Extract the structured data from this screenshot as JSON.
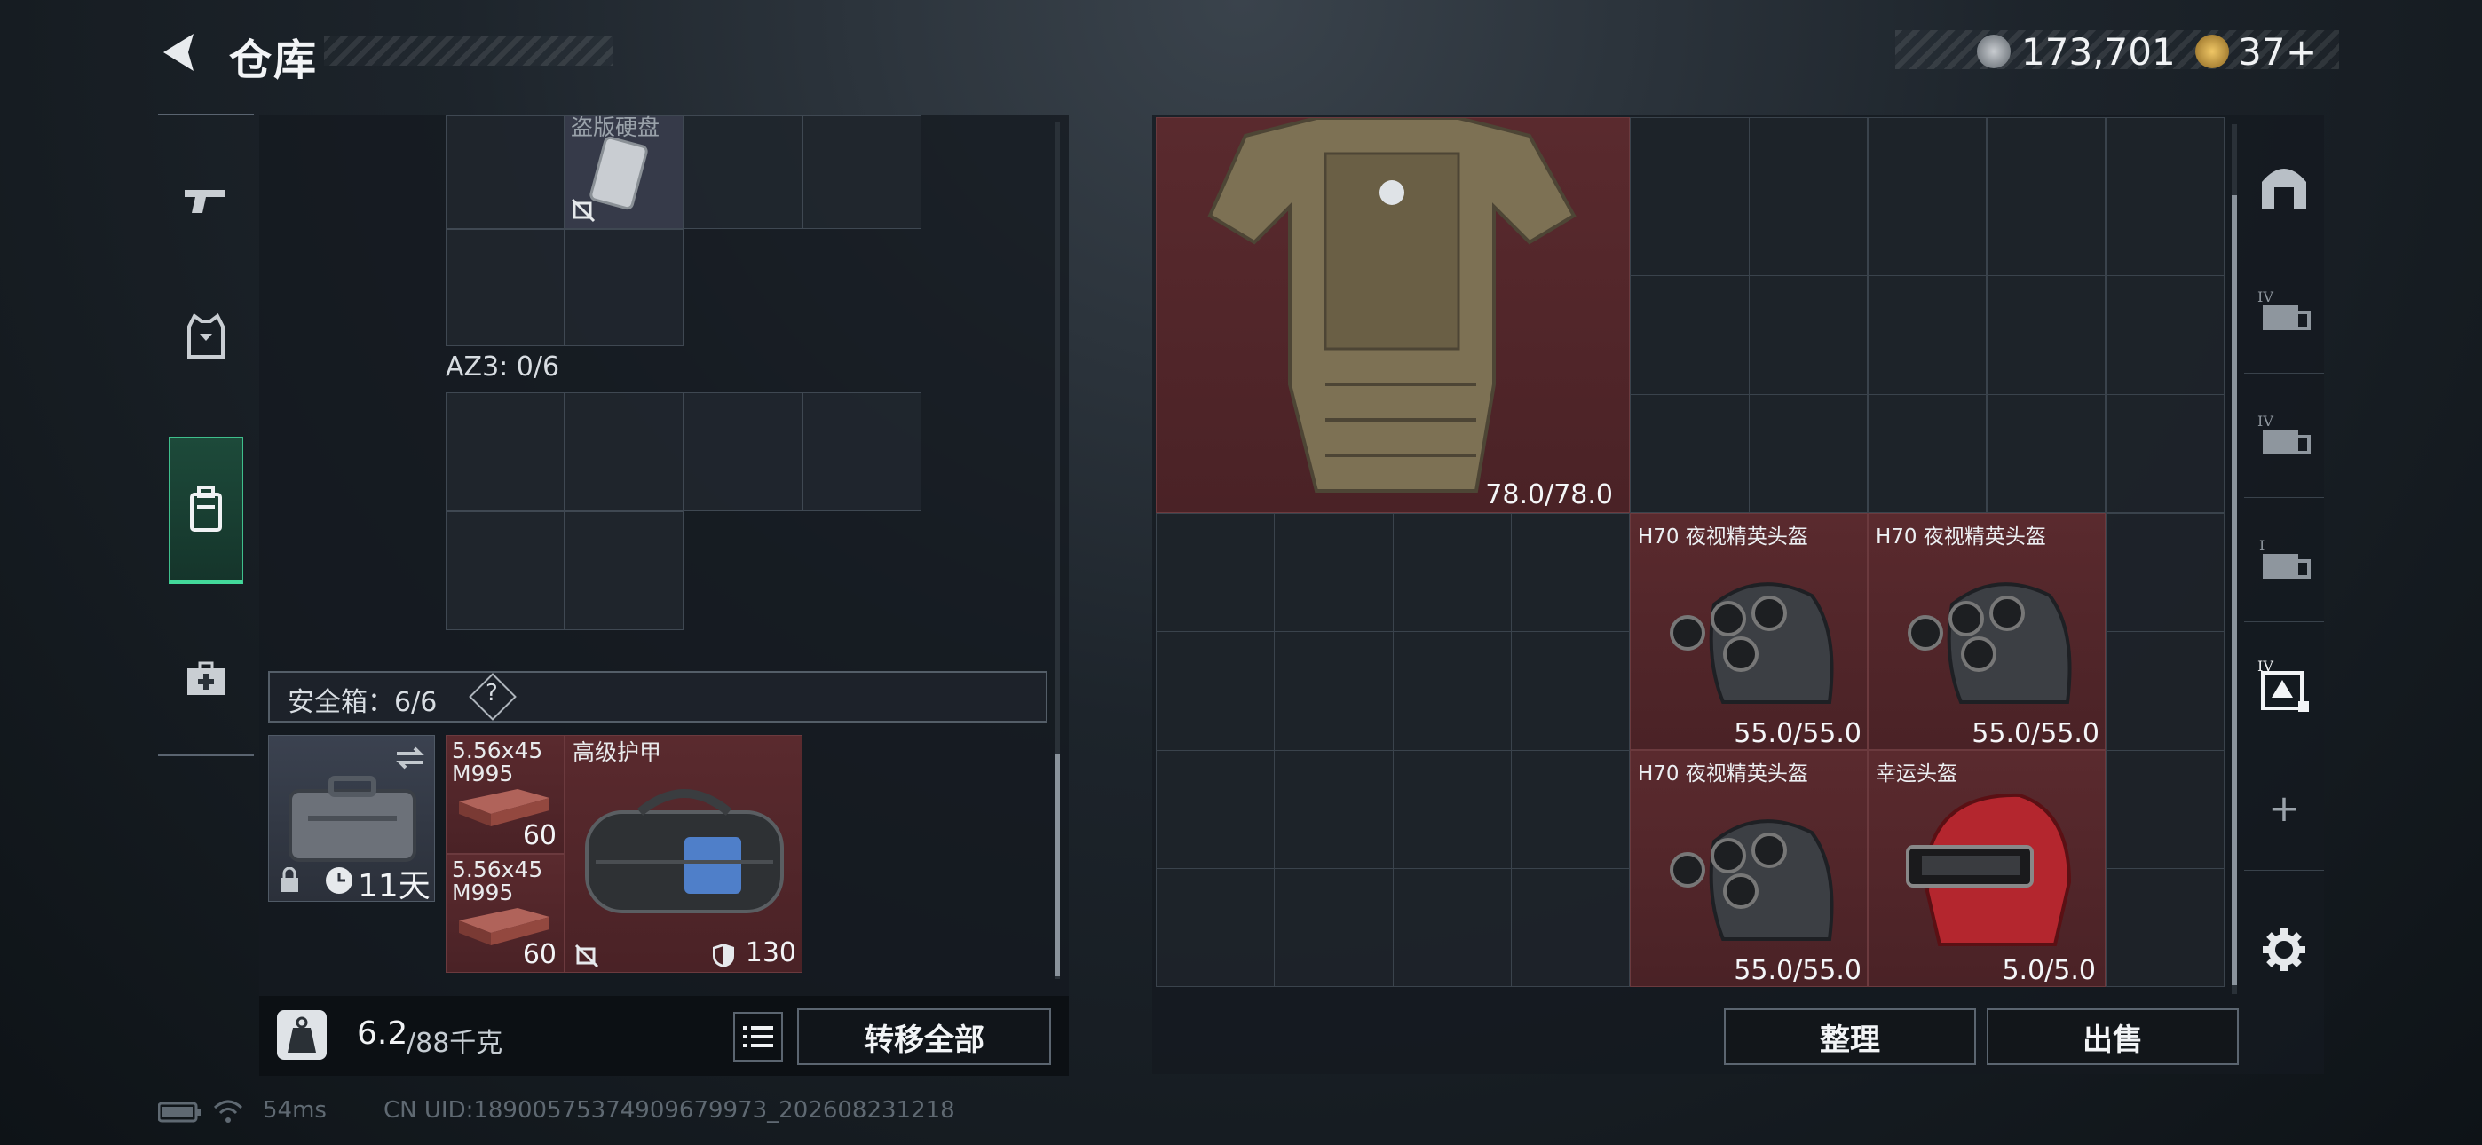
{
  "header": {
    "title": "仓库"
  },
  "currency": {
    "coins": "173,701",
    "tokens": "37",
    "add_symbol": "+"
  },
  "categories": [
    {
      "name": "weapons",
      "icon": "pistol-icon"
    },
    {
      "name": "armor",
      "icon": "chest-rig-icon"
    },
    {
      "name": "backpack",
      "icon": "backpack-icon",
      "active": true
    },
    {
      "name": "medical",
      "icon": "medkit-icon"
    }
  ],
  "left_panel": {
    "top_item_label": "盗版硬盘",
    "az3_label": "AZ3: 0/6",
    "safe_box": {
      "label": "安全箱：6/6",
      "help": "?",
      "timer": "11天"
    },
    "items": [
      {
        "label": "5.56x45\nM995",
        "count": "60"
      },
      {
        "label": "5.56x45\nM995",
        "count": "60"
      },
      {
        "label": "高级护甲",
        "armor_value": "130"
      }
    ],
    "weight": {
      "current": "6.2",
      "max": "/88千克"
    },
    "transfer_all": "转移全部"
  },
  "right_panel": {
    "vest": {
      "durability": "78.0/78.0"
    },
    "helmets": [
      {
        "name": "H70 夜视精英头盔",
        "durability": "55.0/55.0"
      },
      {
        "name": "H70 夜视精英头盔",
        "durability": "55.0/55.0"
      },
      {
        "name": "H70 夜视精英头盔",
        "durability": "55.0/55.0"
      },
      {
        "name": "幸运头盔",
        "durability": "5.0/5.0"
      }
    ],
    "sort_button": "整理",
    "sell_button": "出售",
    "add_symbol": "+"
  },
  "status": {
    "ping": "54ms",
    "uid": "CN UID:18900575374909679973_202608231218"
  },
  "colors": {
    "accent": "#43d99b",
    "item_red": "#4f2428",
    "panel": "#141a20"
  }
}
